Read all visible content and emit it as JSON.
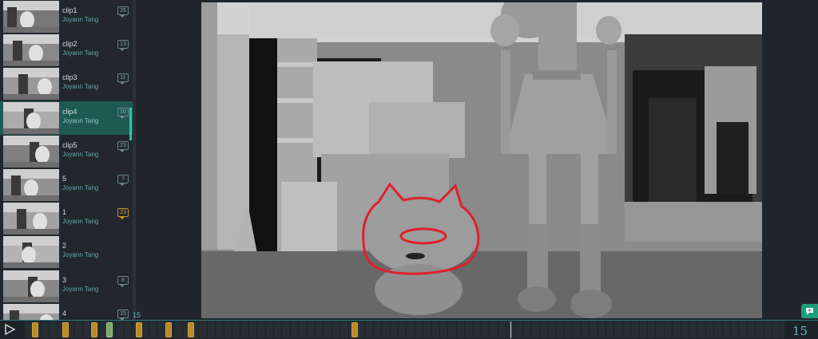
{
  "clips": [
    {
      "name": "clip1",
      "author": "Joyann Tang",
      "count": "25",
      "hot": false,
      "active": false
    },
    {
      "name": "clip2",
      "author": "Joyann Tang",
      "count": "13",
      "hot": false,
      "active": false
    },
    {
      "name": "clip3",
      "author": "Joyann Tang",
      "count": "11",
      "hot": false,
      "active": false
    },
    {
      "name": "clip4",
      "author": "Joyann Tang",
      "count": "10",
      "hot": false,
      "active": true
    },
    {
      "name": "clip5",
      "author": "Joyann Tang",
      "count": "23",
      "hot": false,
      "active": false
    },
    {
      "name": "5",
      "author": "Joyann Tang",
      "count": "7",
      "hot": false,
      "active": false
    },
    {
      "name": "1",
      "author": "Joyann Tang",
      "count": "23",
      "hot": true,
      "active": false
    },
    {
      "name": "2",
      "author": "Joyann Tang",
      "count": "",
      "hot": false,
      "active": false
    },
    {
      "name": "3",
      "author": "Joyann Tang",
      "count": "8",
      "hot": false,
      "active": false
    },
    {
      "name": "4",
      "author": "Joyann Tang",
      "count": "15",
      "hot": false,
      "active": false
    }
  ],
  "timeline": {
    "frame_badge": "15",
    "frame_count": "15",
    "play_icon": "play-icon"
  },
  "colors": {
    "accent": "#2bc7a4",
    "annotation": "#e0202a",
    "marker": "#b98a2a"
  }
}
